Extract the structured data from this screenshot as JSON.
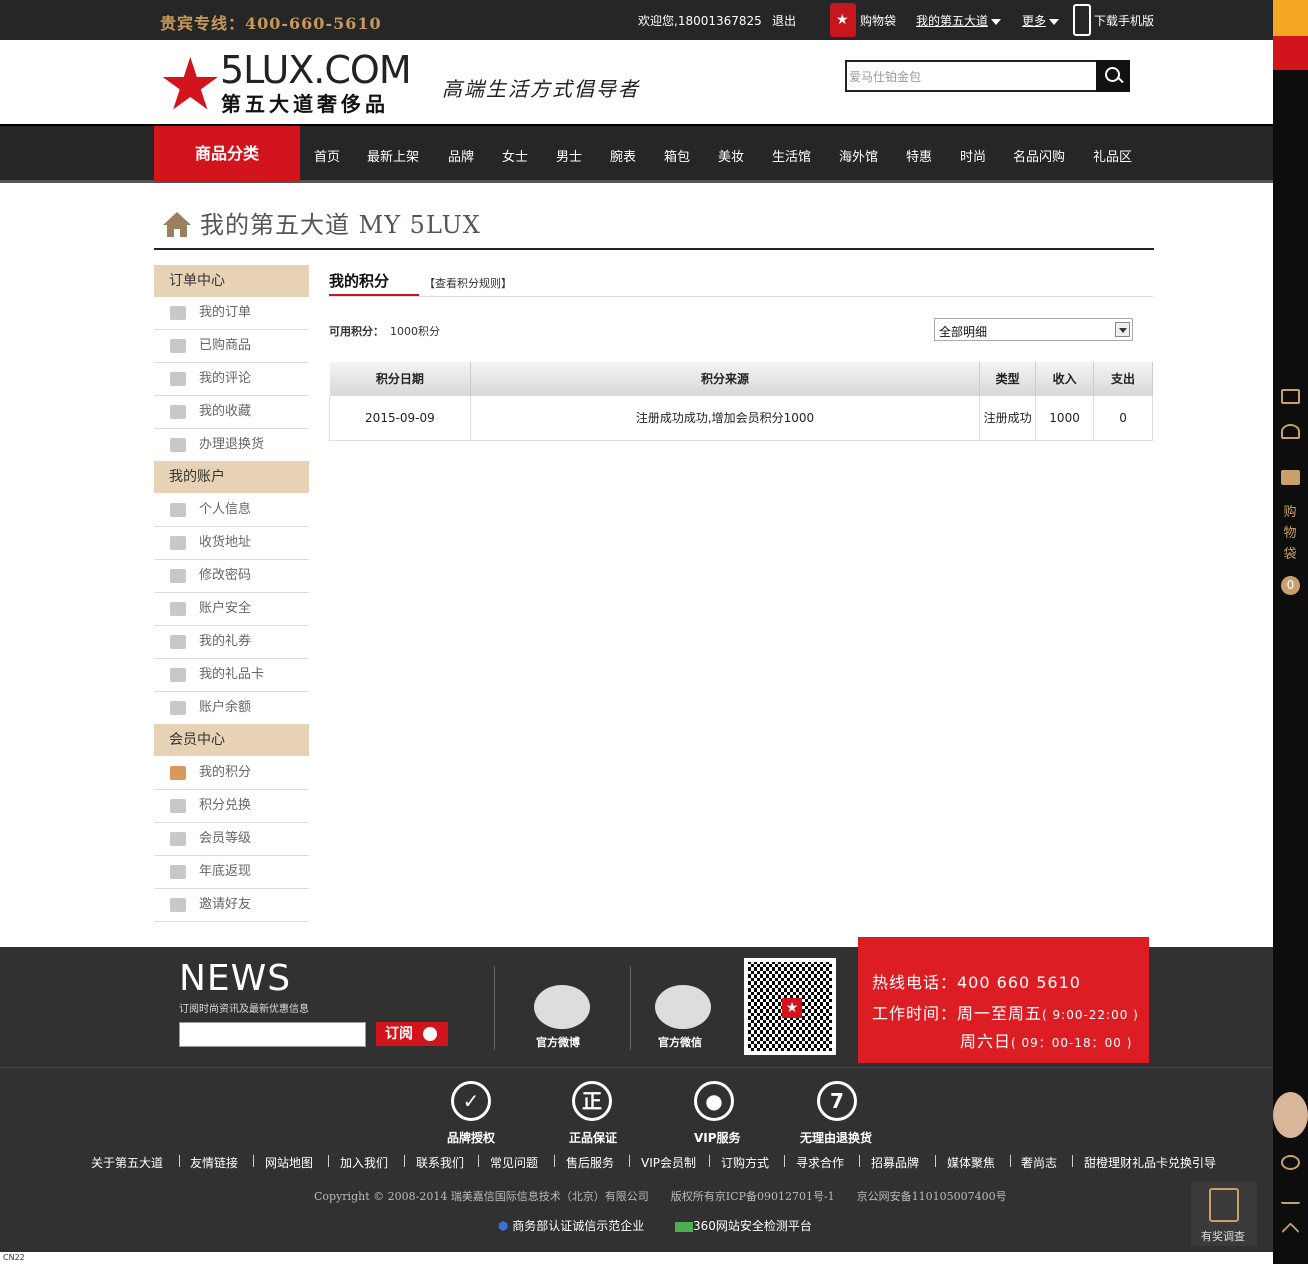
{
  "topbar": {
    "hotline": "贵宾专线：400-660-5610",
    "welcome": "欢迎您,18001367825",
    "logout": "退出",
    "cart": "购物袋",
    "my_5lux": "我的第五大道",
    "more": "更多",
    "download": "下载手机版"
  },
  "header": {
    "logo_en": "5LUX.COM",
    "logo_cn": "第五大道奢侈品",
    "slogan": "高端生活方式倡导者",
    "search_placeholder": "爱马仕铂金包"
  },
  "nav": {
    "category": "商品分类",
    "items": [
      "首页",
      "最新上架",
      "品牌",
      "女士",
      "男士",
      "腕表",
      "箱包",
      "美妆",
      "生活馆",
      "海外馆",
      "特惠",
      "时尚",
      "名品闪购",
      "礼品区"
    ]
  },
  "page": {
    "title": "我的第五大道 MY 5LUX"
  },
  "sidebar": {
    "sections": [
      {
        "title": "订单中心",
        "items": [
          "我的订单",
          "已购商品",
          "我的评论",
          "我的收藏",
          "办理退换货"
        ]
      },
      {
        "title": "我的账户",
        "items": [
          "个人信息",
          "收货地址",
          "修改密码",
          "账户安全",
          "我的礼券",
          "我的礼品卡",
          "账户余额"
        ]
      },
      {
        "title": "会员中心",
        "items": [
          "我的积分",
          "积分兑换",
          "会员等级",
          "年底返现",
          "邀请好友"
        ]
      }
    ],
    "active_item": "我的积分"
  },
  "main": {
    "tab": "我的积分",
    "rules_link": "【查看积分规则】",
    "available_label": "可用积分：",
    "available_value": "1000积分",
    "filter_selected": "全部明细",
    "table": {
      "headers": [
        "积分日期",
        "积分来源",
        "类型",
        "收入",
        "支出"
      ],
      "rows": [
        [
          "2015-09-09",
          "注册成功成功,增加会员积分1000",
          "注册成功",
          "1000",
          "0"
        ]
      ]
    }
  },
  "footer": {
    "news_title": "NEWS",
    "news_sub": "订阅时尚资讯及最新优惠信息",
    "subscribe": "订阅",
    "weibo": "官方微博",
    "weixin": "官方微信",
    "hotline": "热线电话：400 660 5610",
    "hours_label": "工作时间：周一至周五",
    "hours_weekday": "( 9:00-22:00 )",
    "saturday": "周六日",
    "hours_saturday": "( 09：00-18：00 )",
    "badges": [
      "品牌授权",
      "正品保证",
      "VIP服务",
      "无理由退换货"
    ],
    "badge_glyphs": [
      "✓",
      "正",
      "●",
      "7"
    ],
    "links": [
      "关于第五大道",
      "友情链接",
      "网站地图",
      "加入我们",
      "联系我们",
      "常见问题",
      "售后服务",
      "VIP会员制",
      "订购方式",
      "寻求合作",
      "招募品牌",
      "媒体聚焦",
      "奢尚志",
      "甜橙理财礼品卡兑换引导"
    ],
    "copyright": "Copyright © 2008-2014 瑞美嘉信国际信息技术（北京）有限公司　　版权所有京ICP备09012701号-1　　京公网安备110105007400号",
    "cert1": "商务部认证诚信示范企业",
    "cert2": "360网站安全检测平台",
    "status_tag": "CN22"
  },
  "rail": {
    "cart_text": "购物袋",
    "cart_count": "0",
    "survey": "有奖调查"
  },
  "colors": {
    "brand_red": "#d2141c",
    "gold": "#c79a5b",
    "dark": "#262626",
    "sidebar_head": "#e8d2b6"
  }
}
